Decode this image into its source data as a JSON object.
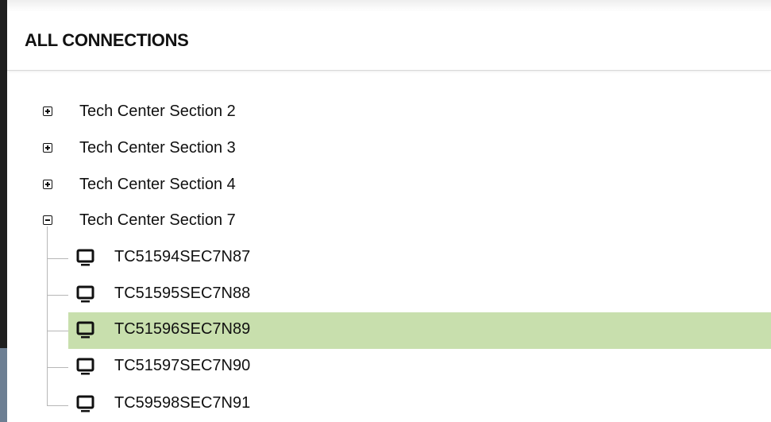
{
  "header": {
    "title": "ALL CONNECTIONS"
  },
  "tree": {
    "sections": [
      {
        "label": "Tech Center Section 2",
        "expanded": false
      },
      {
        "label": "Tech Center Section 3",
        "expanded": false
      },
      {
        "label": "Tech Center Section 4",
        "expanded": false
      },
      {
        "label": "Tech Center Section 7",
        "expanded": true
      }
    ],
    "children": [
      {
        "label": "TC51594SEC7N87",
        "selected": false,
        "icon": "monitor-icon"
      },
      {
        "label": "TC51595SEC7N88",
        "selected": false,
        "icon": "monitor-icon"
      },
      {
        "label": "TC51596SEC7N89",
        "selected": true,
        "icon": "monitor-icon"
      },
      {
        "label": "TC51597SEC7N90",
        "selected": false,
        "icon": "monitor-icon"
      },
      {
        "label": "TC59598SEC7N91",
        "selected": false,
        "icon": "monitor-icon"
      }
    ]
  },
  "colors": {
    "selection": "#c8dfad",
    "text": "#111111"
  }
}
